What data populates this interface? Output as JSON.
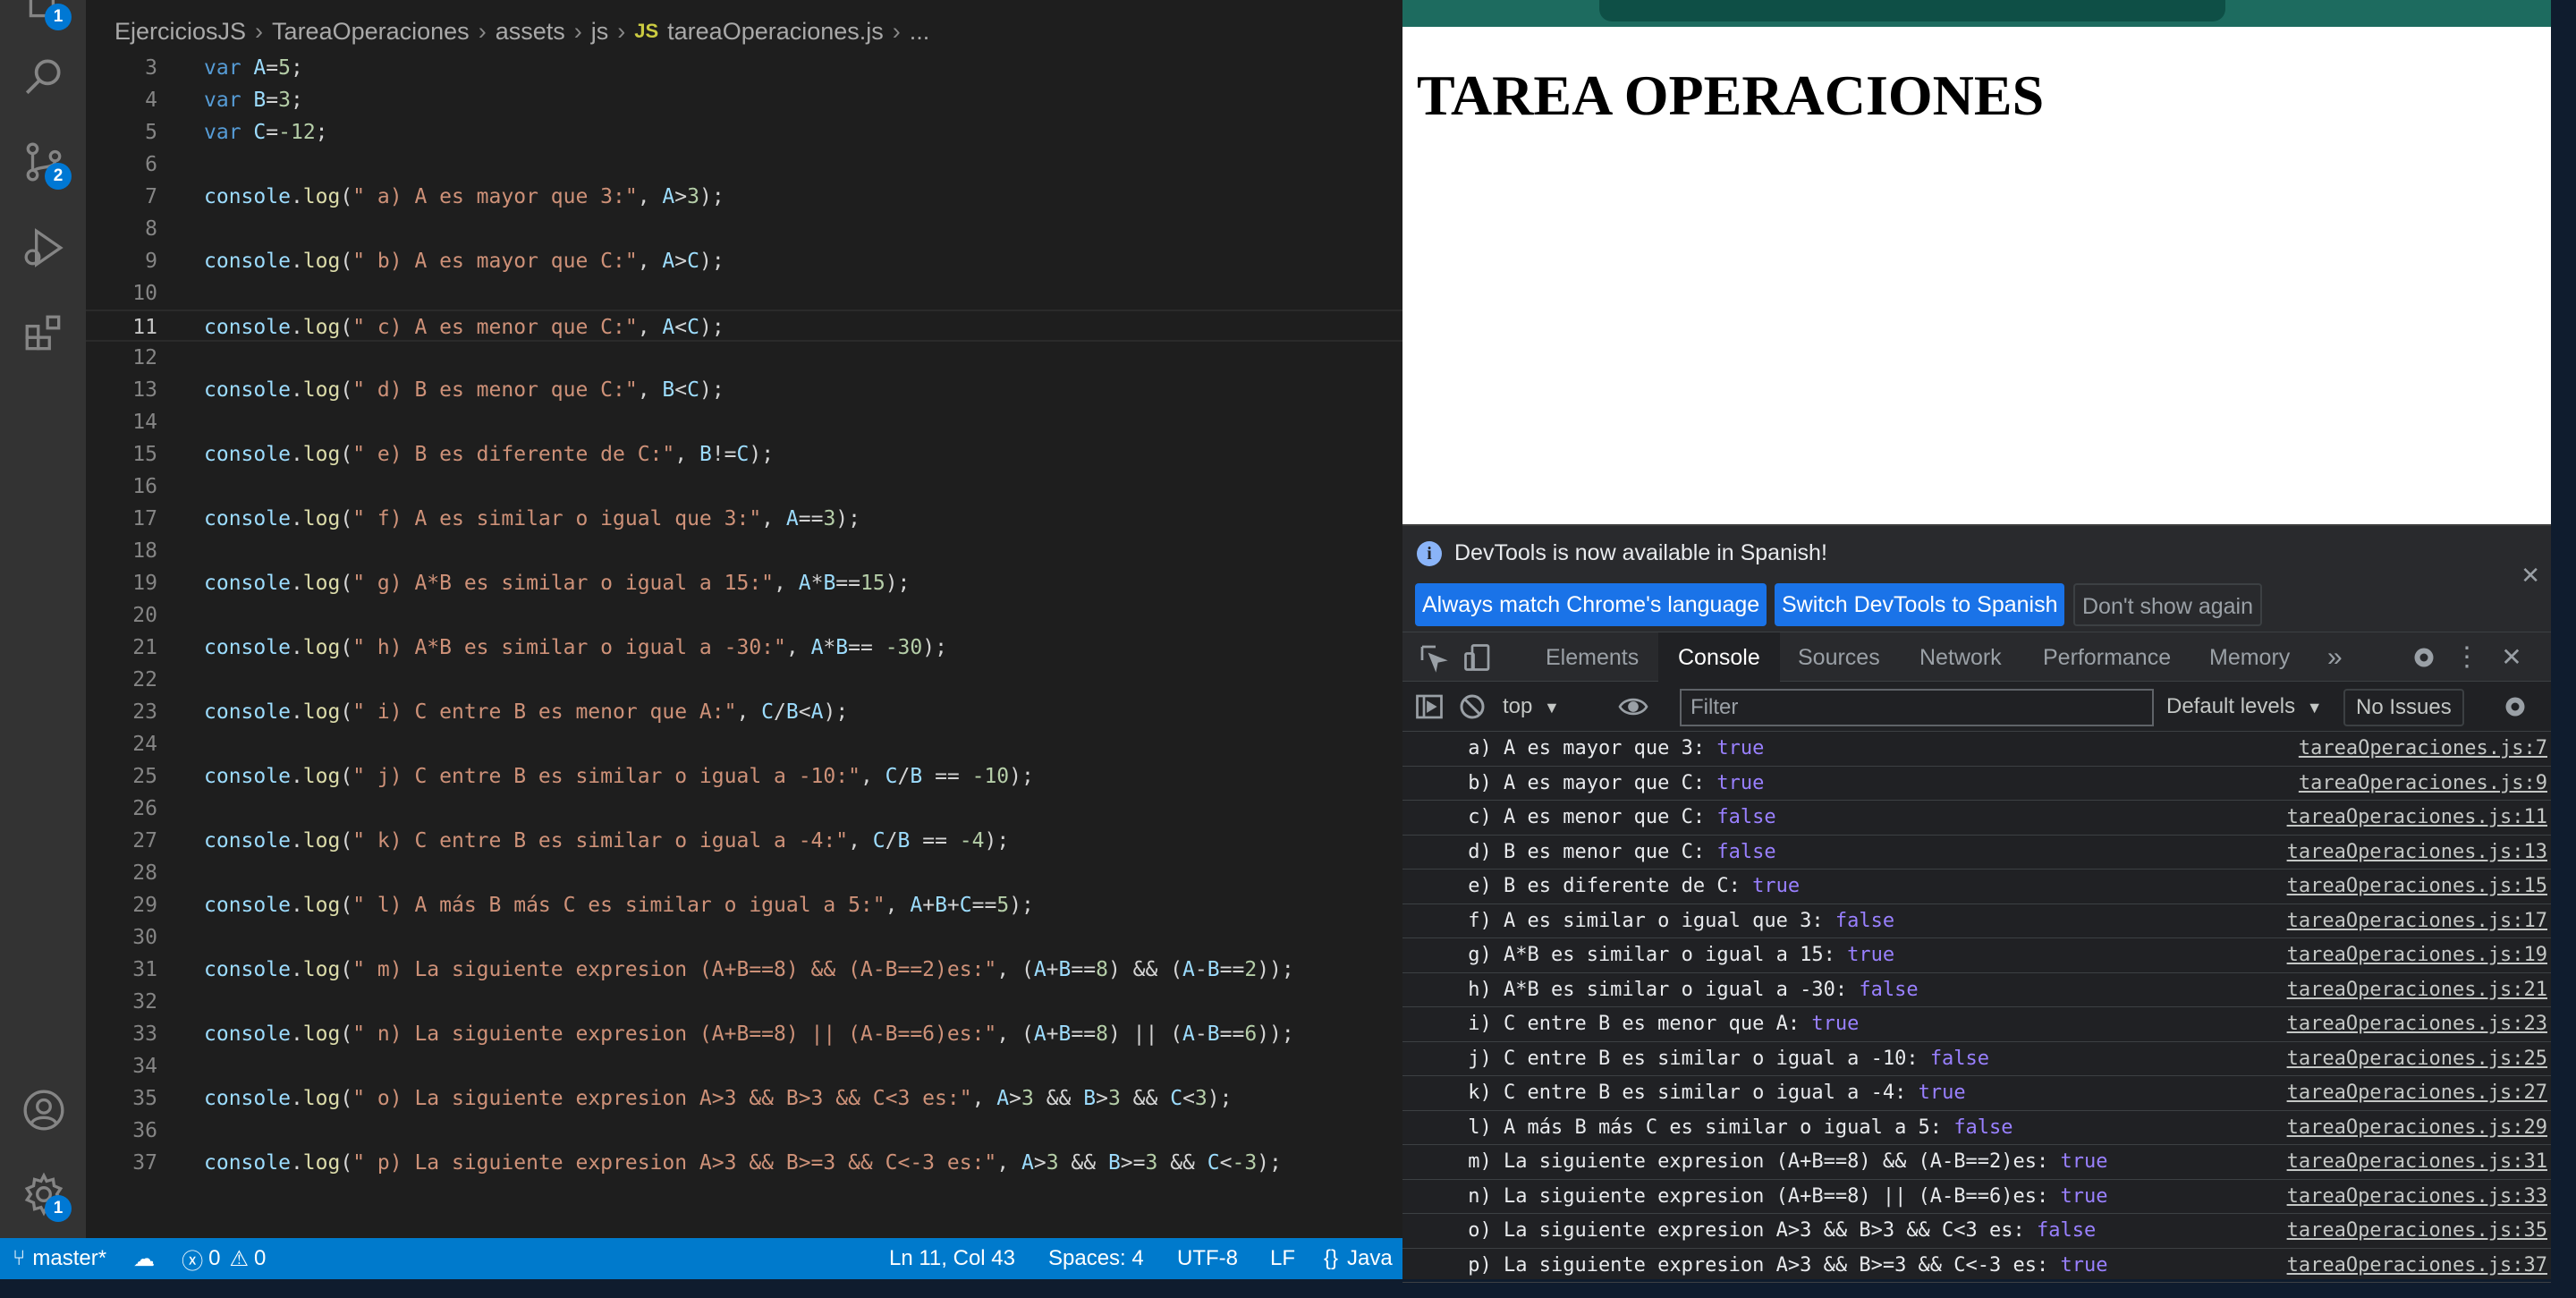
{
  "activity_bar": {
    "explorer_badge": "1",
    "scm_badge": "2",
    "settings_badge": "1"
  },
  "breadcrumb": [
    "EjerciciosJS",
    "TareaOperaciones",
    "assets",
    "js",
    "tareaOperaciones.js",
    "..."
  ],
  "breadcrumb_file_icon": "JS",
  "editor": {
    "current_line": 11,
    "lines": [
      {
        "n": "3",
        "code": "var A=5;"
      },
      {
        "n": "4",
        "code": "var B=3;"
      },
      {
        "n": "5",
        "code": "var C=-12;"
      },
      {
        "n": "6",
        "code": ""
      },
      {
        "n": "7",
        "code": "console.log(\" a) A es mayor que 3:\", A>3);"
      },
      {
        "n": "8",
        "code": ""
      },
      {
        "n": "9",
        "code": "console.log(\" b) A es mayor que C:\", A>C);"
      },
      {
        "n": "10",
        "code": ""
      },
      {
        "n": "11",
        "code": "console.log(\" c) A es menor que C:\", A<C);"
      },
      {
        "n": "12",
        "code": ""
      },
      {
        "n": "13",
        "code": "console.log(\" d) B es menor que C:\", B<C);"
      },
      {
        "n": "14",
        "code": ""
      },
      {
        "n": "15",
        "code": "console.log(\" e) B es diferente de C:\", B!=C);"
      },
      {
        "n": "16",
        "code": ""
      },
      {
        "n": "17",
        "code": "console.log(\" f) A es similar o igual que 3:\", A==3);"
      },
      {
        "n": "18",
        "code": ""
      },
      {
        "n": "19",
        "code": "console.log(\" g) A*B es similar o igual a 15:\", A*B==15);"
      },
      {
        "n": "20",
        "code": ""
      },
      {
        "n": "21",
        "code": "console.log(\" h) A*B es similar o igual a -30:\", A*B== -30);"
      },
      {
        "n": "22",
        "code": ""
      },
      {
        "n": "23",
        "code": "console.log(\" i) C entre B es menor que A:\", C/B<A);"
      },
      {
        "n": "24",
        "code": ""
      },
      {
        "n": "25",
        "code": "console.log(\" j) C entre B es similar o igual a -10:\", C/B == -10);"
      },
      {
        "n": "26",
        "code": ""
      },
      {
        "n": "27",
        "code": "console.log(\" k) C entre B es similar o igual a -4:\", C/B == -4);"
      },
      {
        "n": "28",
        "code": ""
      },
      {
        "n": "29",
        "code": "console.log(\" l) A más B más C es similar o igual a 5:\", A+B+C==5);"
      },
      {
        "n": "30",
        "code": ""
      },
      {
        "n": "31",
        "code": "console.log(\" m) La siguiente expresion (A+B==8) && (A-B==2)es:\", (A+B==8) && (A-B==2));"
      },
      {
        "n": "32",
        "code": ""
      },
      {
        "n": "33",
        "code": "console.log(\" n) La siguiente expresion (A+B==8) || (A-B==6)es:\", (A+B==8) || (A-B==6));"
      },
      {
        "n": "34",
        "code": ""
      },
      {
        "n": "35",
        "code": "console.log(\" o) La siguiente expresion A>3 && B>3 && C<3 es:\", A>3 && B>3 && C<3);"
      },
      {
        "n": "36",
        "code": ""
      },
      {
        "n": "37",
        "code": "console.log(\" p) La siguiente expresion A>3 && B>=3 && C<-3 es:\", A>3 && B>=3 && C<-3);"
      }
    ]
  },
  "statusbar": {
    "branch": "master*",
    "errors": "0",
    "warnings": "0",
    "position": "Ln 11, Col 43",
    "spaces": "Spaces: 4",
    "encoding": "UTF-8",
    "eol": "LF",
    "language": "Java"
  },
  "browser": {
    "page_heading": "TAREA OPERACIONES"
  },
  "devtools": {
    "banner_message": "DevTools is now available in Spanish!",
    "btn_match": "Always match Chrome's language",
    "btn_switch": "Switch DevTools to Spanish",
    "btn_dont_show": "Don't show again",
    "tabs": [
      "Elements",
      "Console",
      "Sources",
      "Network",
      "Performance",
      "Memory"
    ],
    "active_tab": "Console",
    "context": "top",
    "filter_placeholder": "Filter",
    "levels": "Default levels",
    "issues": "No Issues",
    "console": [
      {
        "msg": " a) A es mayor que 3:",
        "val": "true",
        "src": "tareaOperaciones.js:7"
      },
      {
        "msg": " b) A es mayor que C:",
        "val": "true",
        "src": "tareaOperaciones.js:9"
      },
      {
        "msg": " c) A es menor que C:",
        "val": "false",
        "src": "tareaOperaciones.js:11"
      },
      {
        "msg": " d) B es menor que C:",
        "val": "false",
        "src": "tareaOperaciones.js:13"
      },
      {
        "msg": " e) B es diferente de C:",
        "val": "true",
        "src": "tareaOperaciones.js:15"
      },
      {
        "msg": " f) A es similar o igual que 3:",
        "val": "false",
        "src": "tareaOperaciones.js:17"
      },
      {
        "msg": " g) A*B es similar o igual a 15:",
        "val": "true",
        "src": "tareaOperaciones.js:19"
      },
      {
        "msg": " h) A*B es similar o igual a -30:",
        "val": "false",
        "src": "tareaOperaciones.js:21"
      },
      {
        "msg": " i) C entre B es menor que A:",
        "val": "true",
        "src": "tareaOperaciones.js:23"
      },
      {
        "msg": " j) C entre B es similar o igual a -10:",
        "val": "false",
        "src": "tareaOperaciones.js:25"
      },
      {
        "msg": " k) C entre B es similar o igual a -4:",
        "val": "true",
        "src": "tareaOperaciones.js:27"
      },
      {
        "msg": " l) A más B más C es similar o igual a 5:",
        "val": "false",
        "src": "tareaOperaciones.js:29"
      },
      {
        "msg": " m) La siguiente expresion (A+B==8) && (A-B==2)es:",
        "val": "true",
        "src": "tareaOperaciones.js:31"
      },
      {
        "msg": " n) La siguiente expresion (A+B==8) || (A-B==6)es:",
        "val": "true",
        "src": "tareaOperaciones.js:33"
      },
      {
        "msg": " o) La siguiente expresion A>3 && B>3 && C<3 es:",
        "val": "false",
        "src": "tareaOperaciones.js:35"
      },
      {
        "msg": " p) La siguiente expresion A>3 && B>=3 && C<-3 es:",
        "val": "true",
        "src": "tareaOperaciones.js:37"
      }
    ]
  }
}
